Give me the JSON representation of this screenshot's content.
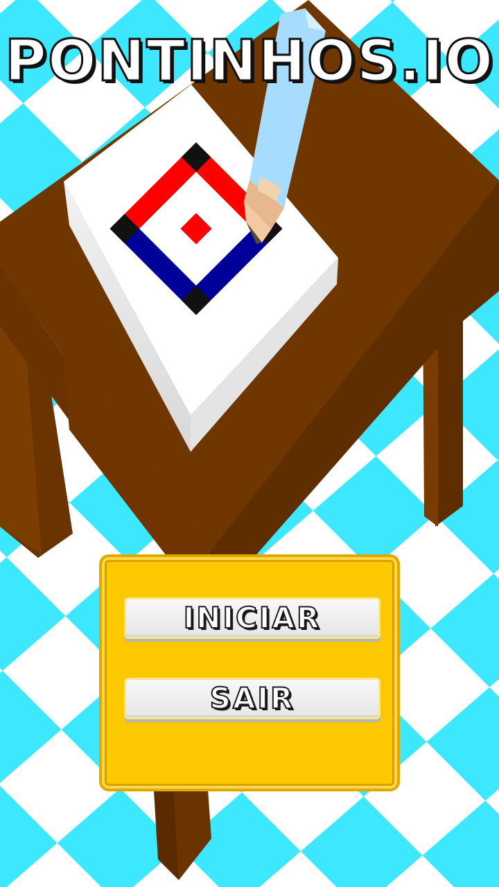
{
  "game": {
    "title": "PONTINHOS.IO"
  },
  "menu": {
    "start_label": "INICIAR",
    "exit_label": "SAIR"
  },
  "colors": {
    "floor_cyan": "#3de8ff",
    "floor_white": "#ffffff",
    "table_top": "#703600",
    "table_side": "#5e2d00",
    "panel_yellow": "#fcc800",
    "artwork_red": "#ff0000",
    "artwork_blue": "#000099",
    "artwork_black": "#111111",
    "pencil_blue": "#a8dcff"
  }
}
